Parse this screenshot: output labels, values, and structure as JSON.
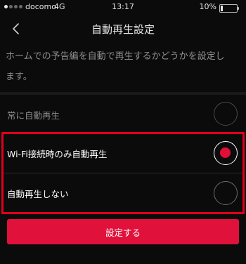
{
  "status_bar": {
    "carrier": "docomo",
    "network": "4G",
    "time": "13:17",
    "battery": "10%",
    "battery_level": 0.1
  },
  "nav": {
    "back_icon": "chevron-left-icon",
    "title": "自動再生設定"
  },
  "description_line1": "ホームでの予告編を自動で再生するかどうかを設定し",
  "description_line2": "ます。",
  "options": [
    {
      "label": "常に自動再生",
      "selected": false
    },
    {
      "label": "Wi-Fi接続時のみ自動再生",
      "selected": true
    },
    {
      "label": "自動再生しない",
      "selected": false
    }
  ],
  "button": {
    "label": "設定する"
  },
  "colors": {
    "background": "#0b0b0b",
    "accent": "#e0113a",
    "highlight_border": "#e0001b"
  }
}
